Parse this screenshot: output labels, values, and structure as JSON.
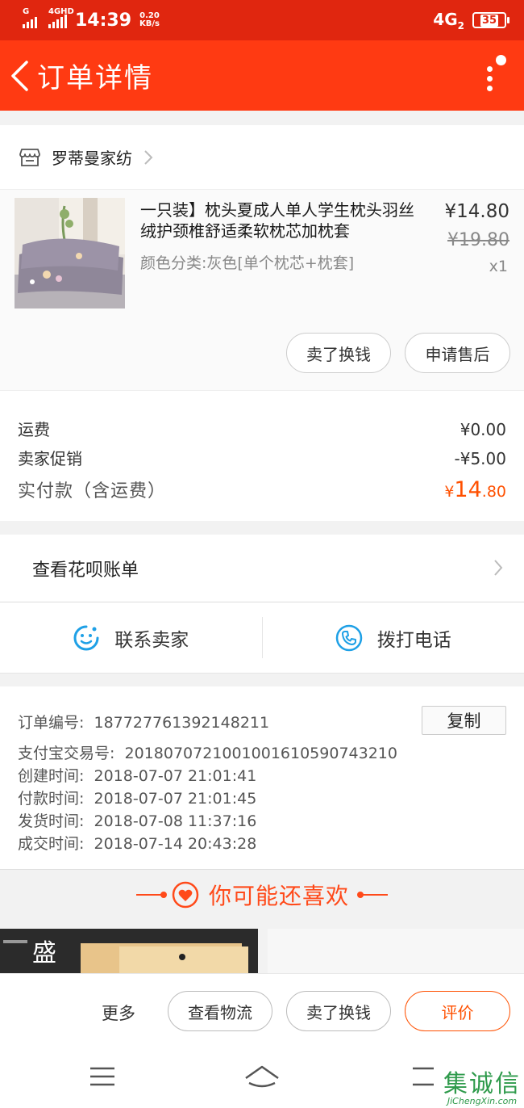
{
  "status_bar": {
    "signal1_label": "G",
    "signal2_label": "4GHD",
    "time": "14:39",
    "speed_value": "0.20",
    "speed_unit": "KB/s",
    "network": "4G",
    "network_sub": "2",
    "battery": "35"
  },
  "nav": {
    "title": "订单详情",
    "back_icon": "chevron-left-icon",
    "more_icon": "more-vertical-icon"
  },
  "shop": {
    "name": "罗蒂曼家纺",
    "icon": "store-icon"
  },
  "product": {
    "title": "一只装】枕头夏成人单人学生枕头羽丝绒护颈椎舒适柔软枕芯加枕套",
    "sku": "颜色分类:灰色[单个枕芯+枕套]",
    "price": "¥14.80",
    "original_price": "¥19.80",
    "quantity": "x1",
    "sell_label": "卖了换钱",
    "aftersale_label": "申请售后"
  },
  "costs": {
    "shipping_label": "运费",
    "shipping_value": "¥0.00",
    "promo_label": "卖家促销",
    "promo_value": "-¥5.00",
    "total_label": "实付款（含运费）",
    "total_currency": "¥",
    "total_int": "14",
    "total_dec": ".80"
  },
  "huabei": {
    "label": "查看花呗账单"
  },
  "contact": {
    "seller_label": "联系卖家",
    "phone_label": "拨打电话"
  },
  "order_info": {
    "copy_label": "复制",
    "rows": [
      {
        "key": "订单编号:",
        "value": "187727761392148211"
      },
      {
        "key": "支付宝交易号:",
        "value": "2018070721001001610590743210"
      },
      {
        "key": "创建时间:",
        "value": "2018-07-07 21:01:41"
      },
      {
        "key": "付款时间:",
        "value": "2018-07-07 21:01:45"
      },
      {
        "key": "发货时间:",
        "value": "2018-07-08 11:37:16"
      },
      {
        "key": "成交时间:",
        "value": "2018-07-14 20:43:28"
      }
    ]
  },
  "recommend": {
    "title": "你可能还喜欢",
    "rec_text": "盛"
  },
  "action_bar": {
    "more_label": "更多",
    "logistics_label": "查看物流",
    "sell_label": "卖了换钱",
    "review_label": "评价"
  },
  "watermark": {
    "main": "集诚信",
    "sub": "JiChengXin.com"
  },
  "colors": {
    "status_bar": "#e0260f",
    "nav_bar": "#ff3a12",
    "accent": "#ff5000",
    "contact_blue": "#1ea0e6"
  }
}
